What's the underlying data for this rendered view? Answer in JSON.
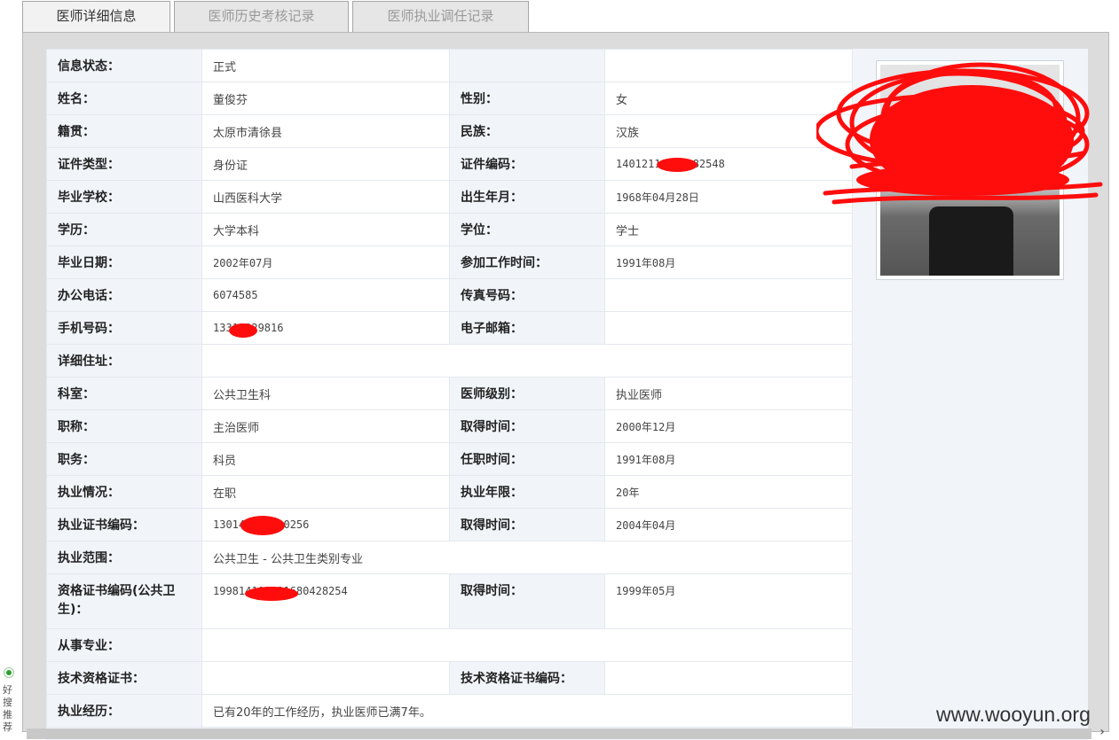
{
  "tabs": [
    {
      "label": "医师详细信息",
      "active": true
    },
    {
      "label": "医师历史考核记录",
      "active": false
    },
    {
      "label": "医师执业调任记录",
      "active": false
    }
  ],
  "rows": [
    {
      "l1": "信息状态：",
      "v1": "正式",
      "l2": "",
      "v2": ""
    },
    {
      "l1": "姓名：",
      "v1": "董俊芬",
      "l2": "性别：",
      "v2": "女"
    },
    {
      "l1": "籍贯：",
      "v1": "太原市清徐县",
      "l2": "民族：",
      "v2": "汉族"
    },
    {
      "l1": "证件类型：",
      "v1": "身份证",
      "l2": "证件编码：",
      "v2": "14012119682282548"
    },
    {
      "l1": "毕业学校：",
      "v1": "山西医科大学",
      "l2": "出生年月：",
      "v2": "1968年04月28日"
    },
    {
      "l1": "学历：",
      "v1": "大学本科",
      "l2": "学位：",
      "v2": "学士"
    },
    {
      "l1": "毕业日期：",
      "v1": "2002年07月",
      "l2": "参加工作时间：",
      "v2": "1991年08月"
    },
    {
      "l1": "办公电话：",
      "v1": "6074585",
      "l2": "传真号码：",
      "v2": ""
    },
    {
      "l1": "手机号码：",
      "v1": "13312329816",
      "l2": "电子邮箱：",
      "v2": ""
    },
    {
      "l1": "详细住址：",
      "v1": ""
    },
    {
      "l1": "科室：",
      "v1": "公共卫生科",
      "l2": "医师级别：",
      "v2": "执业医师"
    },
    {
      "l1": "职称：",
      "v1": "主治医师",
      "l2": "取得时间：",
      "v2": "2000年12月"
    },
    {
      "l1": "职务：",
      "v1": "科员",
      "l2": "任职时间：",
      "v2": "1991年08月"
    },
    {
      "l1": "执业情况：",
      "v1": "在职",
      "l2": "执业年限：",
      "v2": "20年"
    },
    {
      "l1": "执业证书编码：",
      "v1": "130140000000256",
      "l2": "取得时间：",
      "v2": "2004年04月"
    },
    {
      "l1": "执业范围：",
      "v1": "公共卫生 - 公共卫生类别专业"
    },
    {
      "l1": "资格证书编码(公共卫生)：",
      "v1": "199814100021680428254",
      "l2": "取得时间：",
      "v2": "1999年05月"
    },
    {
      "l1": "从事专业：",
      "v1": ""
    },
    {
      "l1": "技术资格证书：",
      "v1": "",
      "l2": "技术资格证书编码：",
      "v2": ""
    },
    {
      "l1": "执业经历：",
      "v1": "已有20年的工作经历，执业医师已满7年。"
    }
  ],
  "watermark": "www.wooyun.org",
  "side_widget": "好搜推荐",
  "colors": {
    "redaction": "#ff0d0d",
    "label_bg": "#f1f5fa",
    "tab_border": "#a6a6a6"
  }
}
